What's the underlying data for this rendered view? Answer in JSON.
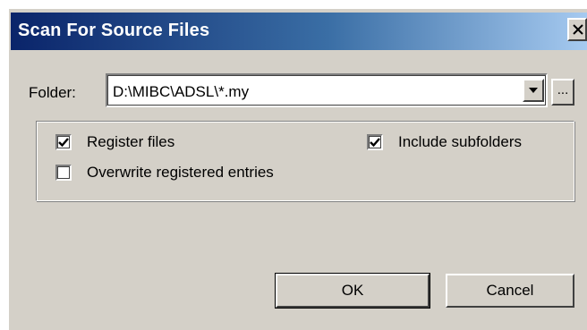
{
  "window": {
    "title": "Scan For Source Files"
  },
  "folder": {
    "label": "Folder:",
    "value": "D:\\MIBC\\ADSL\\*.my",
    "browse_label": "..."
  },
  "options": {
    "register_files": {
      "label": "Register files",
      "checked": true
    },
    "overwrite_entries": {
      "label": "Overwrite registered entries",
      "checked": false
    },
    "include_subfolders": {
      "label": "Include subfolders",
      "checked": true
    }
  },
  "buttons": {
    "ok_label": "OK",
    "cancel_label": "Cancel"
  },
  "colors": {
    "face": "#d4d0c8",
    "title_start": "#0a246a",
    "title_end": "#a6caf0"
  },
  "icons": {
    "close": "close-icon",
    "dropdown": "chevron-down-icon",
    "check": "checkmark-icon"
  }
}
